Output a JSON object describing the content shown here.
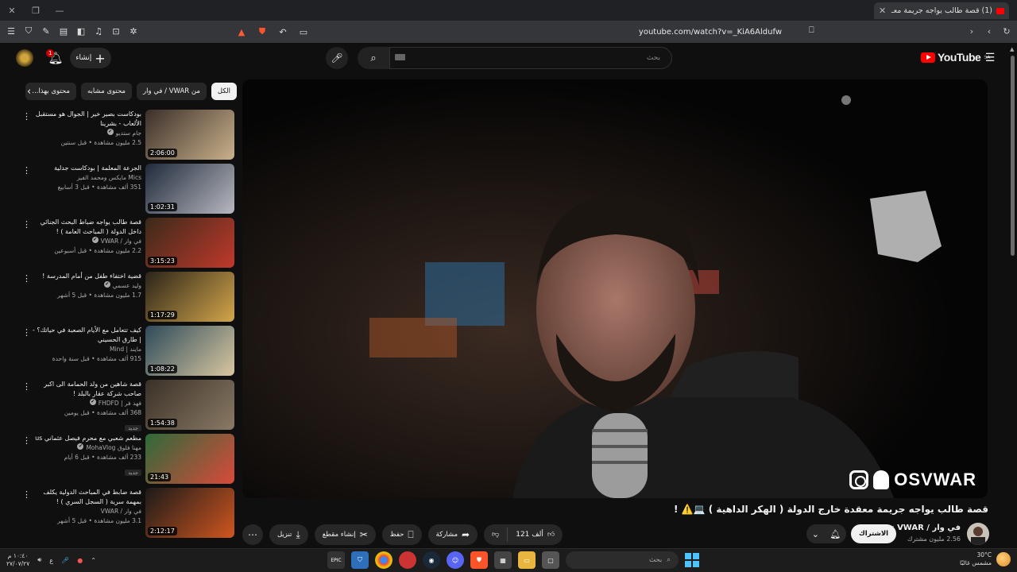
{
  "browser": {
    "tab_title": "(1) قصة طالب يواجه جريمة معـ",
    "url": "youtube.com/watch?v=_KiA6Aldufw",
    "notification_badge": "20"
  },
  "header": {
    "logo_text": "YouTube",
    "logo_region": "SA",
    "search_placeholder": "بحث",
    "create_label": "إنشاء",
    "notif_count": "1"
  },
  "chips": [
    "الكل",
    "من VWAR / في وار",
    "محتوى مشابه",
    "محتوى بهذا..."
  ],
  "recommendations": [
    {
      "title": "بودكاست بصير خير | الجوال هو مستقبل الألعاب - بشرينا",
      "channel": "جام ستديو",
      "stats": "2.5 مليون مشاهدة • قبل سنتين",
      "duration": "2:06:00",
      "verified": true,
      "new": false,
      "colors": [
        "#3b2f2a",
        "#c9b18a"
      ]
    },
    {
      "title": "الجرعة المعلمة | بودكاست جدلية",
      "channel": "Mics مايكس ومحمد الفيز",
      "stats": "351 ألف مشاهدة • قبل 3 أسابيع",
      "duration": "1:02:31",
      "verified": false,
      "new": false,
      "colors": [
        "#1f2a3a",
        "#b8b8c0"
      ]
    },
    {
      "title": "قصة طالب يواجه ضباط البحث الجنائي داخل الدولة ( المباحث العامة ) !",
      "channel": "في وار / VWAR",
      "stats": "2.2 مليون مشاهدة • قبل أسبوعين",
      "duration": "3:15:23",
      "verified": true,
      "new": false,
      "colors": [
        "#3a2a1a",
        "#c0392b"
      ]
    },
    {
      "title": "قضية اختفاء طفل من أمام المدرسة !",
      "channel": "وليد عسمي",
      "stats": "1.7 مليون مشاهدة • قبل 5 أشهر",
      "duration": "1:17:29",
      "verified": true,
      "new": false,
      "colors": [
        "#2a241a",
        "#d4a64a"
      ]
    },
    {
      "title": "كيف تتعامل مع الأيام الصعبة في حياتك؟ - | طارق الحسيني",
      "channel": "مايند | Mind",
      "stats": "915 ألف مشاهدة • قبل سنة واحدة",
      "duration": "1:08:22",
      "verified": false,
      "new": false,
      "colors": [
        "#2e4a5a",
        "#d8c7a0"
      ]
    },
    {
      "title": "قصة شاهين من ولد الحمامة الى اكبر صاحب شركة عقار بالبلد !",
      "channel": "فهد فر | FHDFD",
      "stats": "368 ألف مشاهدة • قبل يومين",
      "duration": "1:54:38",
      "verified": true,
      "new": true,
      "colors": [
        "#3a3026",
        "#8a7a66"
      ]
    },
    {
      "title": "مطعم شعبي مع محرم فيصل عثماني us",
      "channel": "مهنا فلوق MohaVlog",
      "stats": "233 ألف مشاهدة • قبل 6 أيام",
      "duration": "21:43",
      "verified": true,
      "new": true,
      "colors": [
        "#2d6a3a",
        "#d94a3a"
      ]
    },
    {
      "title": "قصة ضابط في المباحث الدولية يكلف بمهمة سرية ( السجل السري ) !",
      "channel": "في وار / VWAR",
      "stats": "3.1 مليون مشاهدة • قبل 5 أشهر",
      "duration": "2:12:17",
      "verified": false,
      "new": false,
      "colors": [
        "#1a1a1a",
        "#d0561e"
      ]
    }
  ],
  "new_label": "جديد",
  "video": {
    "title": "قصة طالب يواجه جريمة معقدة خارج الدولة ( الهكر الداهية ) 💻⚠️ !",
    "watermark": "OSVWAR",
    "channel_name": "في وار / VWAR",
    "subscribers": "2.56 مليون مشترك",
    "subscribe_label": "الاشتراك",
    "likes": "121 ألف",
    "share_label": "مشاركة",
    "save_label": "حفظ",
    "clip_label": "إنشاء مقطع",
    "download_label": "تنزيل"
  },
  "taskbar": {
    "search_placeholder": "بحث",
    "time": "١٠:٤٠ م",
    "date": "٢٧/٠٧/٢٧",
    "lang": "ع",
    "temperature": "30°C",
    "weather": "مشمس غالبًا"
  }
}
